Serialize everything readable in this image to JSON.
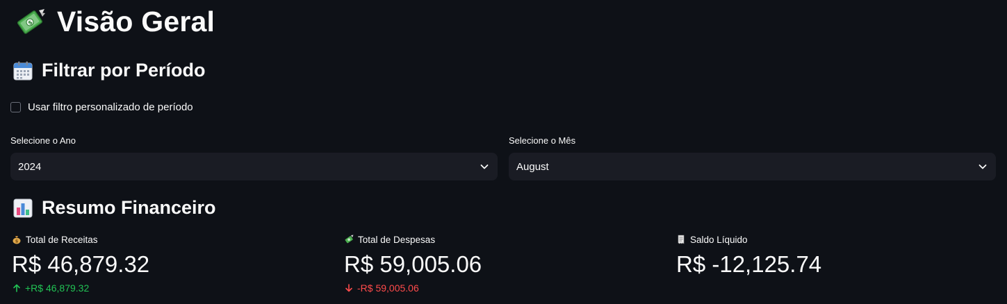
{
  "header": {
    "title": "Visão Geral",
    "title_icon": "money-with-wings-icon"
  },
  "filter_section": {
    "heading": "Filtrar por Período",
    "heading_icon": "calendar-icon",
    "custom_filter_checkbox": {
      "label": "Usar filtro personalizado de período",
      "checked": false
    },
    "year_select": {
      "label": "Selecione o Ano",
      "value": "2024"
    },
    "month_select": {
      "label": "Selecione o Mês",
      "value": "August"
    }
  },
  "summary_section": {
    "heading": "Resumo Financeiro",
    "heading_icon": "bar-chart-icon",
    "metrics": [
      {
        "icon": "money-bag-icon",
        "label": "Total de Receitas",
        "value": "R$ 46,879.32",
        "delta": "+R$ 46,879.32",
        "delta_direction": "up"
      },
      {
        "icon": "money-with-wings-icon",
        "label": "Total de Despesas",
        "value": "R$ 59,005.06",
        "delta": "-R$ 59,005.06",
        "delta_direction": "down"
      },
      {
        "icon": "receipt-icon",
        "label": "Saldo Líquido",
        "value": "R$ -12,125.74",
        "delta": null,
        "delta_direction": null
      }
    ]
  },
  "colors": {
    "background": "#0e1117",
    "select_background": "#1a1c24",
    "text": "#fafafa",
    "delta_up": "#21c354",
    "delta_down": "#ff4b4b"
  }
}
